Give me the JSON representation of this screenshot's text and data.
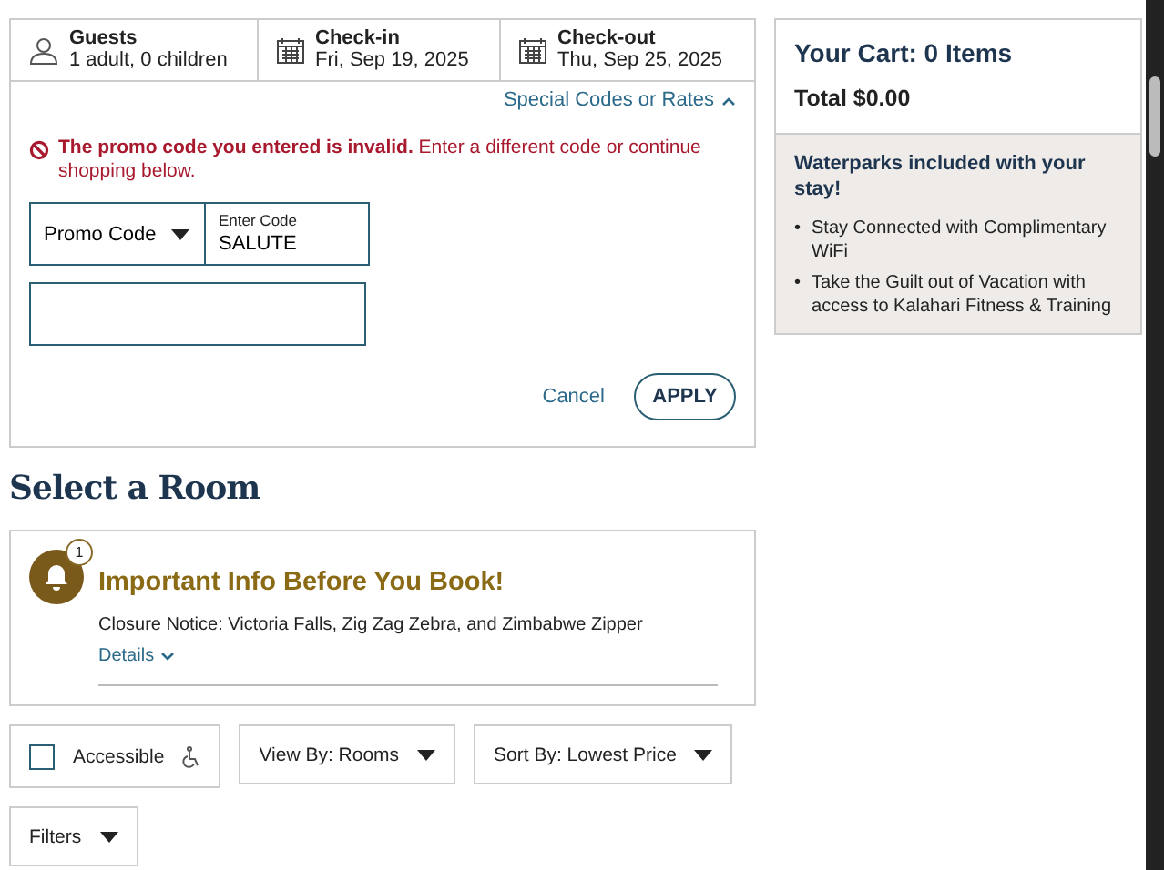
{
  "booking_bar": [
    {
      "kind": "guests",
      "label": "Guests",
      "value": "1 adult, 0 children"
    },
    {
      "kind": "date",
      "label": "Check-in",
      "value": "Fri, Sep 19, 2025"
    },
    {
      "kind": "date",
      "label": "Check-out",
      "value": "Thu, Sep 25, 2025"
    }
  ],
  "special_codes": {
    "toggle": "Special Codes or Rates",
    "expanded": true,
    "error": "**The promo code you entered is invalid.** Enter a different code or continue shopping below.",
    "code_type": "Promo Code",
    "code_field": {
      "label": "Enter Code",
      "value": "SALUTE"
    },
    "cancel": "Cancel",
    "apply": "APPLY"
  },
  "heading": "Select a Room",
  "notice": {
    "badge": "1",
    "title": "Important Info Before You Book!",
    "text": "Closure Notice: Victoria Falls, Zig Zag Zebra, and Zimbabwe Zipper",
    "details": "Details"
  },
  "filters": [
    {
      "kind": "checkbox",
      "label": "Accessible",
      "checked": false
    },
    {
      "kind": "dropdown",
      "label": "View By: Rooms"
    },
    {
      "kind": "dropdown",
      "label": "Sort By: Lowest Price"
    },
    {
      "kind": "dropdown",
      "label": "Filters"
    }
  ],
  "cart": {
    "title": "Your Cart: 0 Items",
    "total": "Total $0.00",
    "promo_title": "Waterparks included with your stay!",
    "perks": [
      {
        "marker": "•",
        "text": "Stay Connected with Complimentary WiFi"
      },
      {
        "marker": "•",
        "text": "Take the Guilt out of Vacation with access to Kalahari Fitness & Training"
      }
    ]
  }
}
